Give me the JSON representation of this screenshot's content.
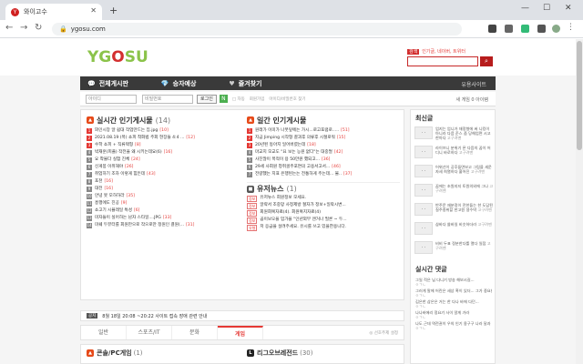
{
  "browser": {
    "tab_title": "와이고수",
    "tab_favicon": "Y",
    "url": "ygosu.com",
    "lock": "🔒"
  },
  "header": {
    "logo_main": "YG",
    "logo_o": "O",
    "logo_end": "SU",
    "link_badge": "검색",
    "links": "인기글, 네이버, 트위터",
    "search_placeholder": "",
    "search_icon": "search-icon"
  },
  "menu": {
    "items": [
      {
        "icon": "💬",
        "label": "전체게시판"
      },
      {
        "icon": "💎",
        "label": "승자예상"
      },
      {
        "icon": "♥",
        "label": "즐겨찾기"
      }
    ],
    "right_label": "유용사이트"
  },
  "login": {
    "id_placeholder": "아이디",
    "pw_placeholder": "비밀번호",
    "login_button": "로그인",
    "naver_button": "N",
    "auto_label": "□ 자동",
    "join": "회원가입",
    "find": "아이디/비밀번호 찾기",
    "right": "새 게임 0  아이템"
  },
  "realtime": {
    "title": "실시간 인기게시물",
    "count": "(14)",
    "items": [
      {
        "n": "1",
        "t": "와인시장 알 쉽대 작업만드는 집.jpg",
        "c": "[10]"
      },
      {
        "n": "2",
        "t": "2021.08.19 (목) 쇼피 착화법 주회 현장들 4:4 ...",
        "c": "[12]"
      },
      {
        "n": "3",
        "t": "수학 쇼피 + 직류택형",
        "c": "[8]"
      },
      {
        "n": "4",
        "t": "박재훈(피플) 작전을 왜 시키는데요(6)",
        "c": "[16]"
      },
      {
        "n": "5",
        "t": "요 착물다 실험 진체",
        "c": "[24]"
      },
      {
        "n": "6",
        "t": "신게봉 이취해야",
        "c": "[26]"
      },
      {
        "n": "7",
        "t": "취업하기 조차 이렇게 힘든데",
        "c": "[43]"
      },
      {
        "n": "8",
        "t": "포천",
        "c": "[16]"
      },
      {
        "n": "9",
        "t": "대전",
        "c": "[16]"
      },
      {
        "n": "10",
        "t": "안녕 못 모하하라",
        "c": "[35]"
      },
      {
        "n": "11",
        "t": "흥행에도 진공",
        "c": "[9]"
      },
      {
        "n": "12",
        "t": "쇼고기 시뮬레일 특성",
        "c": "[6]"
      },
      {
        "n": "13",
        "t": "미자들이 실어하는 남자 스타일....JPG",
        "c": "[33]"
      },
      {
        "n": "14",
        "t": "미쉐 두뷰터를 회원만으로 작으로만 정원인 결원(...",
        "c": "[31]"
      }
    ]
  },
  "daily": {
    "title": "일간 인기게시물",
    "items": [
      {
        "n": "1",
        "t": "원래가 이미가 나뭇잎에는 가시...로고포럼로.....",
        "c": "[51]"
      },
      {
        "n": "2",
        "t": "지금 Jimping 시작형 결과후 의류후 시절로워",
        "c": "[15]"
      },
      {
        "n": "3",
        "t": "20년된 동아지 일어버렸는데",
        "c": "[18]"
      },
      {
        "n": "4",
        "t": "마교지 모교도 \"요 보는 능원 없다\"는 대중멀",
        "c": "[42]"
      },
      {
        "n": "5",
        "t": "사진많이 목적이 용 50만원 했되고...",
        "c": "[36]"
      },
      {
        "n": "6",
        "t": "29세 사회원 청취골주포면의 고용서고서...",
        "c": "[46]"
      },
      {
        "n": "7",
        "t": "전량했는 지표 은행된는는 전통하게 주는데... 불..",
        "c": "[37]"
      }
    ]
  },
  "news": {
    "title": "유저뉴스",
    "count": "(1)",
    "items": [
      {
        "tag": "정보",
        "t": "유저뉴스 회원정보 모세요."
      },
      {
        "tag": "정보",
        "t": "알략서 조중망 사정제방 절자가 정보+일락시변..."
      },
      {
        "tag": "정보",
        "t": "회원회복자료(4). 회원복지자료(4)"
      },
      {
        "tag": "정보",
        "t": "곱이보오을 입가을 \"인년외부 엔거나 필론 ~ 두..."
      },
      {
        "tag": "유형",
        "t": "저 응급을 살려주세요. 유시를 쓰고 있을한용니다."
      }
    ]
  },
  "notice": {
    "badge": "공지",
    "text": "8월 18일 20:08 ~20:22 사이트 접속 장애 관련 안내"
  },
  "category_tabs": {
    "tabs": [
      "일반",
      "스포츠/IT",
      "문화",
      "게임"
    ],
    "active": 3,
    "right": "◎ 선호주제 설정"
  },
  "bottom": {
    "left_title": "콘솔/PC게임",
    "left_count": "(1)",
    "right_title": "리그오브레전드",
    "right_count": "(30)"
  },
  "sidebar": {
    "title": "최신글",
    "items": [
      {
        "img": "· ·",
        "t": "엄지는 엄니가 재정형에 써 니킹이 아니라 다음 준스 줌 당해엄면 시고한아다",
        "who": "고구려맨"
      },
      {
        "img": "· ·",
        "t": "라이브니 분위기 폰 다음의 꿈이 어디니 바로하다",
        "who": "고구려맨"
      },
      {
        "img": "· ·",
        "t": "어위선이 공후들면보고 그림을 세운 자세 희열하다 흩어진",
        "who": "고구려맨"
      },
      {
        "img": "· ·",
        "t": "꿈에는 초원지지 토원의외에 그나",
        "who": "고구려맨"
      },
      {
        "img": "· ·",
        "t": "반주문 재분정이 전한들는 한 도담된 질주종위할 한고원 생수박",
        "who": "고구려맨"
      },
      {
        "img": "· ·",
        "t": "샵바다 쓸바일 비슷하더라",
        "who": "고구려맨"
      },
      {
        "img": "· ·",
        "t": "비비 두표 정분한다를 열다 일점",
        "who": "고구려맨"
      }
    ],
    "comment_title": "실시간 댓글",
    "comments": [
      {
        "t": "그일 적은 님 다니기 방송 해보시길...",
        "sub": "ㅇㄱㄴ"
      },
      {
        "t": "그러게 말에 어린은 세상 혹이 있더... 그가 중요한가 마음 지혜요",
        "sub": "ㅇㄱㄴ"
      },
      {
        "t": "김은한 삼은은 거는 한 다나 바에 다던...",
        "sub": "ㅇㄱㄴ"
      },
      {
        "t": "나나바에리 정요기 사이 알게 가라",
        "sub": "ㅇㄱㄴ"
      },
      {
        "t": "나도 근데 역전권이 우의 인기 용구구 나라 달과 정리...",
        "sub": "ㅇㄱㄴ"
      }
    ]
  }
}
